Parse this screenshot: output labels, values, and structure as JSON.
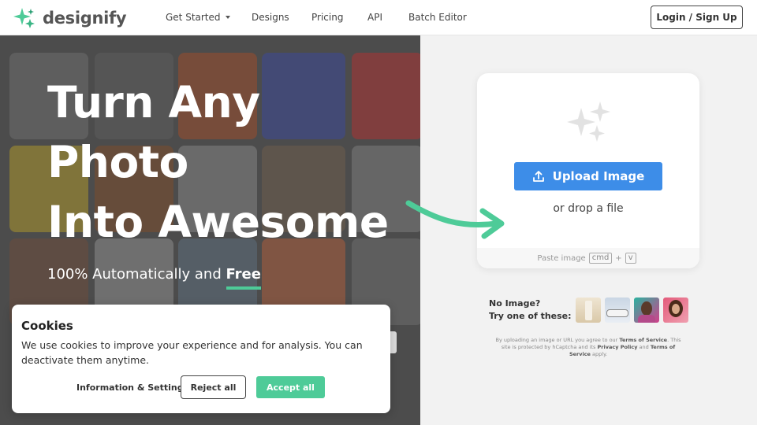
{
  "header": {
    "logo_text": "designify",
    "nav": [
      {
        "label": "Get Started",
        "has_dropdown": true
      },
      {
        "label": "Designs"
      },
      {
        "label": "Pricing"
      },
      {
        "label": "API"
      },
      {
        "label": "Batch Editor"
      }
    ],
    "login_label": "Login / Sign Up"
  },
  "hero": {
    "title_lines": [
      "Turn Any",
      "Photo",
      "Into Awesome"
    ],
    "subtitle_prefix": "100% Automatically and ",
    "subtitle_emphasis": "Free"
  },
  "upload": {
    "button_label": "Upload Image",
    "drop_text": "or drop a file",
    "paste_label": "Paste image",
    "paste_key_1": "cmd",
    "paste_plus": "+",
    "paste_key_2": "v"
  },
  "samples": {
    "prompt_line1": "No Image?",
    "prompt_line2": "Try one of these:",
    "thumbnails": [
      "sample-bottle",
      "sample-car",
      "sample-person-man",
      "sample-person-woman"
    ]
  },
  "terms": {
    "text_1": "By uploading an image or URL you agree to our ",
    "link_1": "Terms of Service",
    "text_2": ". This site is protected by hCaptcha and its ",
    "link_2": "Privacy Policy",
    "text_3": " and ",
    "link_3": "Terms of Service",
    "text_4": " apply."
  },
  "cookie": {
    "title": "Cookies",
    "text": "We use cookies to improve your experience and for analysis. You can deactivate them anytime.",
    "info_label": "Information & Settings",
    "reject_label": "Reject all",
    "accept_label": "Accept all"
  },
  "colors": {
    "accent_green": "#4ecb98",
    "upload_blue": "#3d8de8"
  }
}
